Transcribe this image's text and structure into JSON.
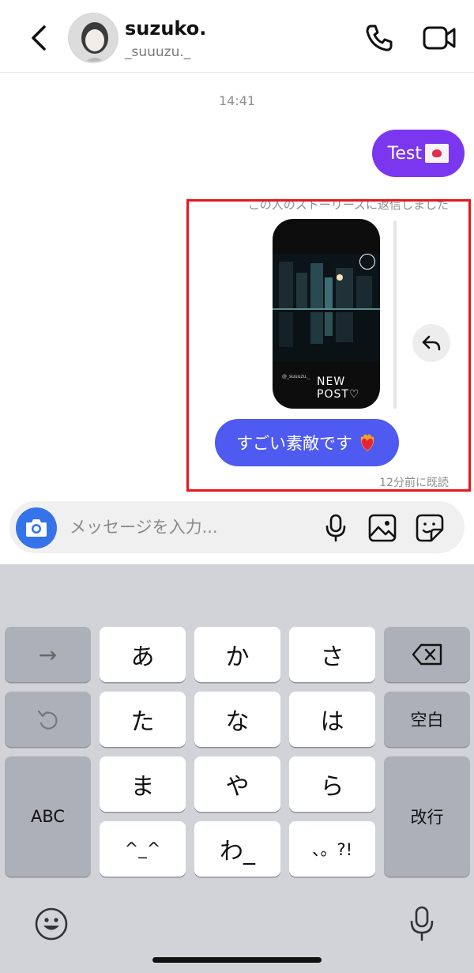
{
  "header": {
    "name": "suzuko.",
    "handle": "_suuuzu._"
  },
  "chat": {
    "time": "14:41",
    "message_test": "Test",
    "story_reply_note": "この人のストーリーズに返信しました",
    "story": {
      "user": "@_suuuzu._",
      "caption": "NEW POST♡"
    },
    "message_reply": "すごい素敵です",
    "read_status": "12分前に既読"
  },
  "composer": {
    "placeholder": "メッセージを入力..."
  },
  "keyboard": {
    "row1": [
      "→",
      "あ",
      "か",
      "さ",
      "⌫"
    ],
    "row2": [
      "↺",
      "た",
      "な",
      "は",
      "空白"
    ],
    "row3": [
      "ABC",
      "ま",
      "や",
      "ら",
      "改行"
    ],
    "row4": [
      "^_^",
      "わ_",
      "、。?!"
    ]
  },
  "colors": {
    "accent_purple": "#7b37ef",
    "accent_blue": "#4f5af0",
    "highlight_red": "#e8161f",
    "camera_blue": "#3473ea"
  }
}
